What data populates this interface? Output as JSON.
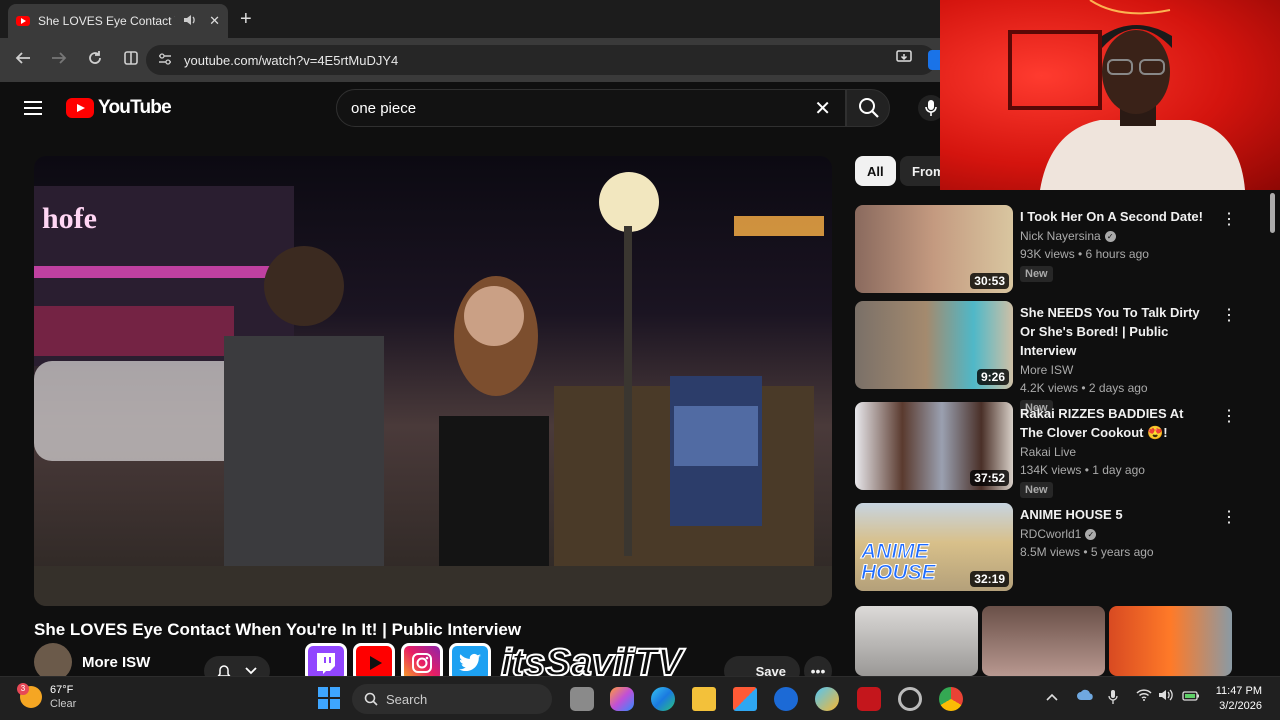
{
  "browser": {
    "tab_title": "She LOVES Eye Contact Wh",
    "tab_audio_icon": "speaker-icon",
    "tab_close": "✕",
    "new_tab": "+",
    "url": "youtube.com/watch?v=4E5rtMuDJY4"
  },
  "youtube": {
    "logo_text": "YouTube",
    "search_query": "one piece",
    "clear_symbol": "✕"
  },
  "video": {
    "title": "She LOVES Eye Contact When You're In It! | Public Interview",
    "channel": "More ISW",
    "save_label": "Save",
    "more_symbol": "•••"
  },
  "chips": [
    {
      "label": "All",
      "active": true
    },
    {
      "label": "From",
      "active": false
    }
  ],
  "recommendations": [
    {
      "title": "I Took Her On A Second Date!",
      "channel": "Nick Nayersina",
      "verified": true,
      "stats": "93K views • 6 hours ago",
      "badge": "New",
      "duration": "30:53"
    },
    {
      "title": "She NEEDS You To Talk Dirty Or She's Bored! | Public Interview",
      "channel": "More ISW",
      "verified": false,
      "stats": "4.2K views • 2 days ago",
      "badge": "New",
      "duration": "9:26"
    },
    {
      "title": "Rakai RIZZES BADDIES At The Clover Cookout 😍!",
      "channel": "Rakai Live",
      "verified": false,
      "stats": "134K views • 1 day ago",
      "badge": "New",
      "duration": "37:52"
    },
    {
      "title": "ANIME HOUSE 5",
      "channel": "RDCworld1",
      "verified": true,
      "stats": "8.5M views • 5 years ago",
      "badge": "",
      "duration": "32:19"
    }
  ],
  "overlay": {
    "handle": "itsSaviiTV",
    "thumb_text": "ANIME HOUSE"
  },
  "taskbar": {
    "weather_temp": "67°F",
    "weather_cond": "Clear",
    "weather_badge": "3",
    "search_label": "Search",
    "time": "11:47 PM",
    "date": "3/2/2026"
  },
  "colors": {
    "yt_red": "#ff0000",
    "background": "#0f0f0f",
    "webcam_red": "#d4140e"
  }
}
